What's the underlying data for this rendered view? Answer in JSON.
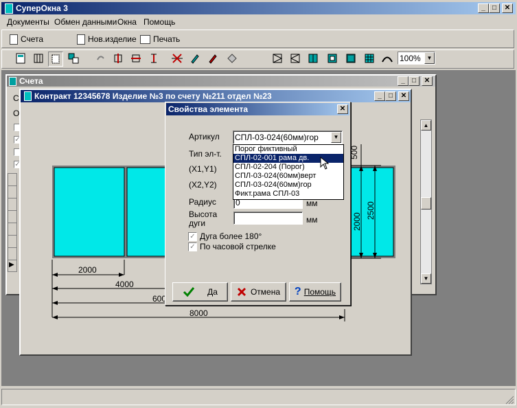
{
  "app": {
    "title": "СуперОкна 3"
  },
  "menu": [
    "Документы",
    "Обмен данными",
    "Окна",
    "Помощь"
  ],
  "toolbar": {
    "accounts": "Счета",
    "new_item": "Нов.изделие",
    "print": "Печать"
  },
  "zoom": {
    "value": "100%"
  },
  "accounts_window": {
    "title": "Счета"
  },
  "contract_window": {
    "title": "Контракт 12345678 Изделие №3 по счету №211 отдел №23"
  },
  "drawing": {
    "dim_2000": "2000",
    "dim_4000": "4000",
    "dim_6000": "600",
    "dim_8000": "8000",
    "dim_v500": "500",
    "dim_v2000": "2000",
    "dim_v2500": "2500",
    "glass_color": "#00e8e8"
  },
  "dialog": {
    "title": "Свойства элемента",
    "article_label": "Артикул",
    "article_value": "СПЛ-03-024(60мм)гор",
    "type_label": "Тип эл-т.",
    "x1y1_label": "(X1,Y1)",
    "x2y2_label": "(X2,Y2)",
    "radius_label": "Радиус",
    "radius_value": "0",
    "radius_unit": "мм",
    "arc_height_label_1": "Высота",
    "arc_height_label_2": "дуги",
    "arc_height_unit": "мм",
    "arc_over_180": "Дуга более 180°",
    "clockwise": "По часовой стрелке",
    "ok": "Да",
    "cancel": "Отмена",
    "help": "Помощь",
    "dropdown_options": [
      "Порог фиктивный",
      "СПЛ-02-001 рама дв.",
      "СПЛ-02-204 (Порог)",
      "СПЛ-03-024(60мм)верт",
      "СПЛ-03-024(60мм)гор",
      "Фикт.рама СПЛ-03"
    ],
    "selected_index": 1
  },
  "accounts_partial": {
    "c_label_1": "С",
    "c_label_2": "О"
  }
}
